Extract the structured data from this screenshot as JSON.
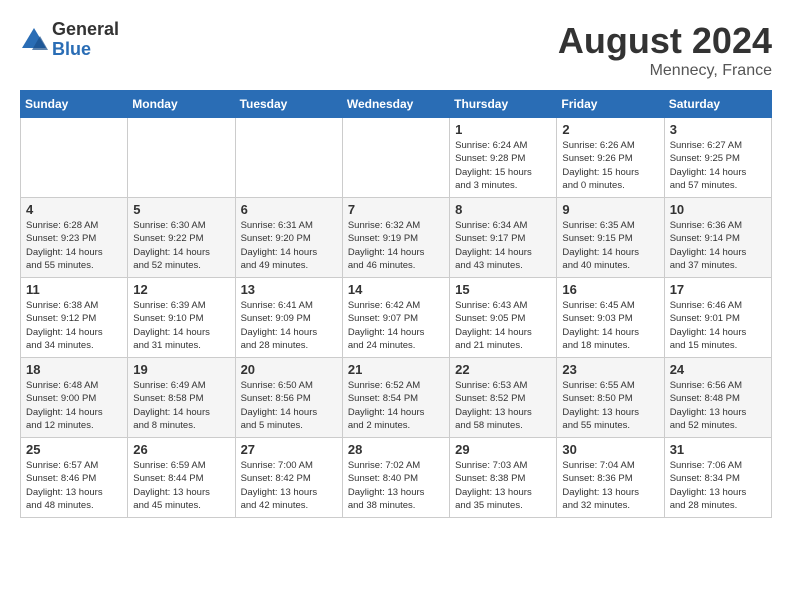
{
  "logo": {
    "general": "General",
    "blue": "Blue"
  },
  "title": {
    "month_year": "August 2024",
    "location": "Mennecy, France"
  },
  "days_of_week": [
    "Sunday",
    "Monday",
    "Tuesday",
    "Wednesday",
    "Thursday",
    "Friday",
    "Saturday"
  ],
  "weeks": [
    [
      {
        "day": "",
        "info": ""
      },
      {
        "day": "",
        "info": ""
      },
      {
        "day": "",
        "info": ""
      },
      {
        "day": "",
        "info": ""
      },
      {
        "day": "1",
        "info": "Sunrise: 6:24 AM\nSunset: 9:28 PM\nDaylight: 15 hours\nand 3 minutes."
      },
      {
        "day": "2",
        "info": "Sunrise: 6:26 AM\nSunset: 9:26 PM\nDaylight: 15 hours\nand 0 minutes."
      },
      {
        "day": "3",
        "info": "Sunrise: 6:27 AM\nSunset: 9:25 PM\nDaylight: 14 hours\nand 57 minutes."
      }
    ],
    [
      {
        "day": "4",
        "info": "Sunrise: 6:28 AM\nSunset: 9:23 PM\nDaylight: 14 hours\nand 55 minutes."
      },
      {
        "day": "5",
        "info": "Sunrise: 6:30 AM\nSunset: 9:22 PM\nDaylight: 14 hours\nand 52 minutes."
      },
      {
        "day": "6",
        "info": "Sunrise: 6:31 AM\nSunset: 9:20 PM\nDaylight: 14 hours\nand 49 minutes."
      },
      {
        "day": "7",
        "info": "Sunrise: 6:32 AM\nSunset: 9:19 PM\nDaylight: 14 hours\nand 46 minutes."
      },
      {
        "day": "8",
        "info": "Sunrise: 6:34 AM\nSunset: 9:17 PM\nDaylight: 14 hours\nand 43 minutes."
      },
      {
        "day": "9",
        "info": "Sunrise: 6:35 AM\nSunset: 9:15 PM\nDaylight: 14 hours\nand 40 minutes."
      },
      {
        "day": "10",
        "info": "Sunrise: 6:36 AM\nSunset: 9:14 PM\nDaylight: 14 hours\nand 37 minutes."
      }
    ],
    [
      {
        "day": "11",
        "info": "Sunrise: 6:38 AM\nSunset: 9:12 PM\nDaylight: 14 hours\nand 34 minutes."
      },
      {
        "day": "12",
        "info": "Sunrise: 6:39 AM\nSunset: 9:10 PM\nDaylight: 14 hours\nand 31 minutes."
      },
      {
        "day": "13",
        "info": "Sunrise: 6:41 AM\nSunset: 9:09 PM\nDaylight: 14 hours\nand 28 minutes."
      },
      {
        "day": "14",
        "info": "Sunrise: 6:42 AM\nSunset: 9:07 PM\nDaylight: 14 hours\nand 24 minutes."
      },
      {
        "day": "15",
        "info": "Sunrise: 6:43 AM\nSunset: 9:05 PM\nDaylight: 14 hours\nand 21 minutes."
      },
      {
        "day": "16",
        "info": "Sunrise: 6:45 AM\nSunset: 9:03 PM\nDaylight: 14 hours\nand 18 minutes."
      },
      {
        "day": "17",
        "info": "Sunrise: 6:46 AM\nSunset: 9:01 PM\nDaylight: 14 hours\nand 15 minutes."
      }
    ],
    [
      {
        "day": "18",
        "info": "Sunrise: 6:48 AM\nSunset: 9:00 PM\nDaylight: 14 hours\nand 12 minutes."
      },
      {
        "day": "19",
        "info": "Sunrise: 6:49 AM\nSunset: 8:58 PM\nDaylight: 14 hours\nand 8 minutes."
      },
      {
        "day": "20",
        "info": "Sunrise: 6:50 AM\nSunset: 8:56 PM\nDaylight: 14 hours\nand 5 minutes."
      },
      {
        "day": "21",
        "info": "Sunrise: 6:52 AM\nSunset: 8:54 PM\nDaylight: 14 hours\nand 2 minutes."
      },
      {
        "day": "22",
        "info": "Sunrise: 6:53 AM\nSunset: 8:52 PM\nDaylight: 13 hours\nand 58 minutes."
      },
      {
        "day": "23",
        "info": "Sunrise: 6:55 AM\nSunset: 8:50 PM\nDaylight: 13 hours\nand 55 minutes."
      },
      {
        "day": "24",
        "info": "Sunrise: 6:56 AM\nSunset: 8:48 PM\nDaylight: 13 hours\nand 52 minutes."
      }
    ],
    [
      {
        "day": "25",
        "info": "Sunrise: 6:57 AM\nSunset: 8:46 PM\nDaylight: 13 hours\nand 48 minutes."
      },
      {
        "day": "26",
        "info": "Sunrise: 6:59 AM\nSunset: 8:44 PM\nDaylight: 13 hours\nand 45 minutes."
      },
      {
        "day": "27",
        "info": "Sunrise: 7:00 AM\nSunset: 8:42 PM\nDaylight: 13 hours\nand 42 minutes."
      },
      {
        "day": "28",
        "info": "Sunrise: 7:02 AM\nSunset: 8:40 PM\nDaylight: 13 hours\nand 38 minutes."
      },
      {
        "day": "29",
        "info": "Sunrise: 7:03 AM\nSunset: 8:38 PM\nDaylight: 13 hours\nand 35 minutes."
      },
      {
        "day": "30",
        "info": "Sunrise: 7:04 AM\nSunset: 8:36 PM\nDaylight: 13 hours\nand 32 minutes."
      },
      {
        "day": "31",
        "info": "Sunrise: 7:06 AM\nSunset: 8:34 PM\nDaylight: 13 hours\nand 28 minutes."
      }
    ]
  ]
}
